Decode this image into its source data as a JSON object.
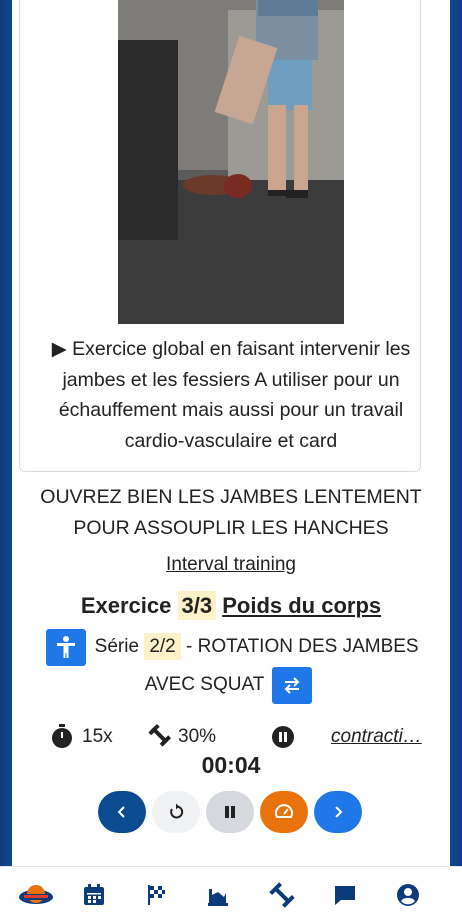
{
  "exercise_card": {
    "description": "▶ Exercice global en faisant intervenir les jambes et les fessiers A utiliser pour un échauffement mais aussi pour un travail cardio-vasculaire et card"
  },
  "hint": {
    "line1": "OUVREZ BIEN LES JAMBES LENTEMENT",
    "line2": "POUR ASSOUPLIR LES HANCHES"
  },
  "training_type": "Interval training",
  "exercise": {
    "label": "Exercice",
    "index": "3/3",
    "equipment": "Poids du corps"
  },
  "serie": {
    "label": "Série",
    "index": "2/2",
    "name_line1": "- ROTATION DES JAMBES",
    "name_line2": "AVEC SQUAT"
  },
  "stats": {
    "reps": "15x",
    "intensity": "30%",
    "mode": "contracti…"
  },
  "timer": "00:04",
  "colors": {
    "navy": "#0a4c8f",
    "blue": "#1f77e8",
    "orange": "#e8730c",
    "grey": "#d5d8dc",
    "light": "#f1f2f4"
  },
  "controls": [
    "chevron-left-icon",
    "replay-icon",
    "pause-icon",
    "speedometer-icon",
    "chevron-right-icon"
  ],
  "nav": [
    "club-logo",
    "calendar-icon",
    "checkered-flag-icon",
    "progress-chart-icon",
    "dumbbell-icon",
    "chat-icon",
    "user-circle-icon"
  ]
}
